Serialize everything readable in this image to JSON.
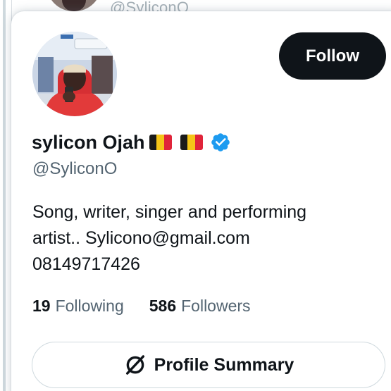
{
  "background_handle": "@SyliconO",
  "profile": {
    "display_name": "sylicon Ojah",
    "handle": "@SyliconO",
    "verified": true,
    "flags": [
      "belgium-flag",
      "belgium-flag"
    ],
    "bio_lines": [
      "Song, writer, singer and performing",
      "artist.. Sylicono@gmail.com",
      "08149717426"
    ]
  },
  "buttons": {
    "follow_label": "Follow",
    "summary_label": "Profile Summary",
    "summary_icon": "no-symbol-icon"
  },
  "stats": {
    "following_count": "19",
    "following_label": "Following",
    "followers_count": "586",
    "followers_label": "Followers"
  },
  "colors": {
    "primary_text": "#0f1419",
    "secondary_text": "#536471",
    "verified_blue": "#1d9bf0",
    "follow_bg": "#0f1419",
    "border": "#cfd9de"
  }
}
